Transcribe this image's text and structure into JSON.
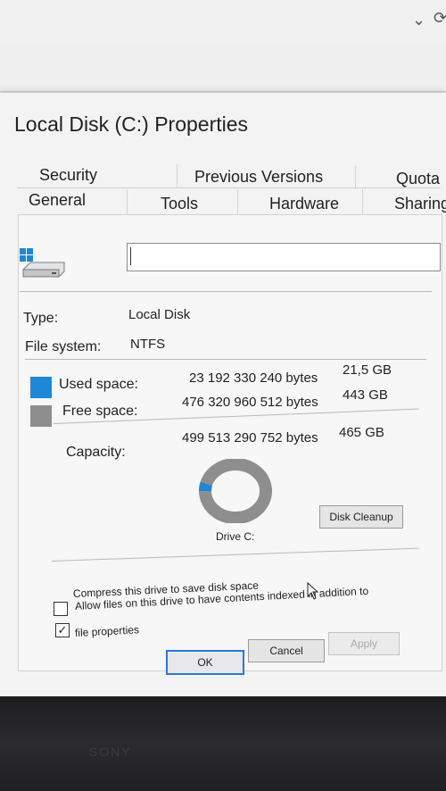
{
  "dialog": {
    "title": "Local Disk (C:) Properties",
    "tabs_top": [
      "Security",
      "Previous Versions",
      "Quota"
    ],
    "tabs_bottom": [
      "General",
      "Tools",
      "Hardware",
      "Sharing"
    ],
    "name_value": ""
  },
  "general": {
    "type_label": "Type:",
    "type_value": "Local Disk",
    "fs_label": "File system:",
    "fs_value": "NTFS",
    "used_label": "Used space:",
    "used_bytes": "23 192 330 240 bytes",
    "used_gb": "21,5 GB",
    "free_label": "Free space:",
    "free_bytes": "476 320 960 512 bytes",
    "free_gb": "443 GB",
    "capacity_label": "Capacity:",
    "capacity_bytes": "499 513 290 752 bytes",
    "capacity_gb": "465 GB",
    "drive_label": "Drive C:",
    "cleanup_button": "Disk Cleanup",
    "used_fraction": 0.043,
    "used_color": "#1e88d6",
    "free_color": "#8e8e8e"
  },
  "options": {
    "compress_label": "Compress this drive to save disk space",
    "compress_checked": false,
    "index_label_1": "Allow files on this drive to have contents indexed in addition to",
    "index_label_2": "file properties",
    "index_checked": true,
    "check_mark": "✓"
  },
  "buttons": {
    "ok": "OK",
    "cancel": "Cancel",
    "apply": "Apply"
  },
  "monitor": {
    "brand": "SONY"
  }
}
